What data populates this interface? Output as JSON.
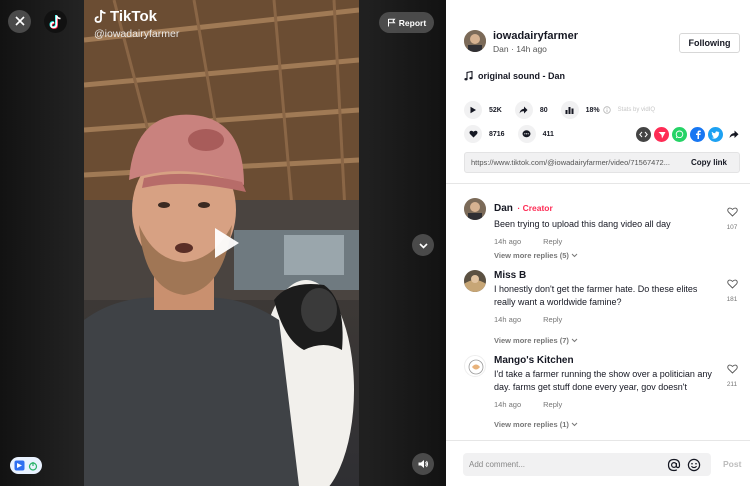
{
  "video": {
    "brand": "TikTok",
    "username": "@iowadairyfarmer",
    "report_label": "Report"
  },
  "author": {
    "handle": "iowadairyfarmer",
    "name": "Dan",
    "time": "14h ago",
    "follow_label": "Following"
  },
  "sound": "original sound - Dan",
  "stats": {
    "plays": "52K",
    "shares": "80",
    "percent": "18%",
    "stats_by": "Stats by vidIQ",
    "likes": "8716",
    "comments": "411"
  },
  "link": {
    "url": "https://www.tiktok.com/@iowadairyfarmer/video/71567472...",
    "copy_label": "Copy link"
  },
  "comments": [
    {
      "name": "Dan",
      "badge": "Creator",
      "text": "Been trying to upload this dang video all day",
      "time": "14h ago",
      "reply": "Reply",
      "likes": "107",
      "view_replies": "View more replies (5)"
    },
    {
      "name": "Miss B",
      "text": "I honestly don't get the farmer hate. Do these elites really want a worldwide famine?",
      "time": "14h ago",
      "reply": "Reply",
      "likes": "181",
      "view_replies": "View more replies (7)"
    },
    {
      "name": "Mango's Kitchen",
      "text": "I'd take a farmer running the show over a politician any day. farms get stuff done every year, gov doesn't",
      "time": "14h ago",
      "reply": "Reply",
      "likes": "211",
      "view_replies": "View more replies (1)"
    }
  ],
  "comment_box": {
    "placeholder": "Add comment...",
    "post_label": "Post"
  },
  "colors": {
    "accent": "#fe2c55",
    "text": "#161823"
  }
}
